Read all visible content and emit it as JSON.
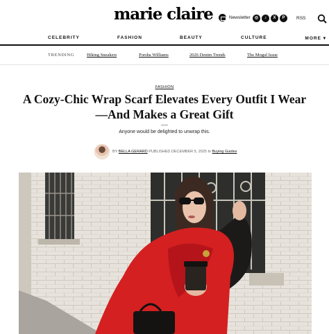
{
  "header": {
    "logo": "marie claire",
    "newsletter_label": "Newsletter",
    "socials": [
      "instagram-icon",
      "tiktok-icon",
      "x-icon",
      "pinterest-icon"
    ],
    "rss_label": "RSS"
  },
  "nav": {
    "items": [
      "CELEBRITY",
      "FASHION",
      "BEAUTY",
      "CULTURE"
    ],
    "more_label": "MORE"
  },
  "trending": {
    "label": "TRENDING",
    "links": [
      "Hiking Sneakers",
      "Porsha Williams",
      "2026 Denim Trends",
      "The Mogul Issue"
    ]
  },
  "article": {
    "section": "FASHION",
    "headline": "A Cozy-Chic Wrap Scarf Elevates Every Outfit I Wear—And Makes a Great Gift",
    "dek": "Anyone would be delighted to unwrap this.",
    "byline": {
      "by": "BY",
      "author": "BELLA GERARD",
      "published": "PUBLISHED DECEMBER 5, 2025",
      "in": "In",
      "category": "Buying Guides"
    }
  },
  "colors": {
    "accent_red": "#d42020",
    "text": "#111111"
  }
}
